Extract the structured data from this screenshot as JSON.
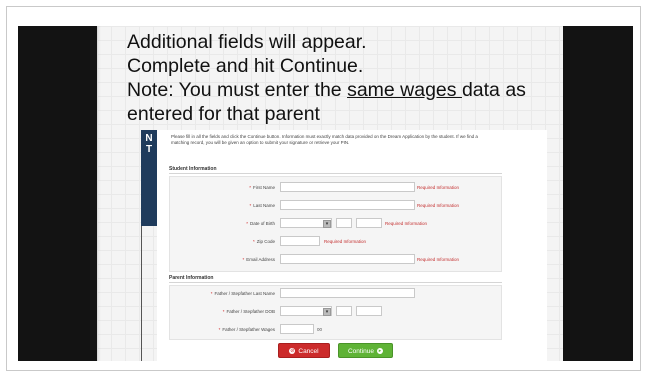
{
  "heading": {
    "line1": "Additional fields will appear.",
    "line2": "Complete and hit Continue.",
    "line3_prefix": "Note: You must enter the ",
    "line3_underlined": "same wages ",
    "line3_suffix": "data as",
    "line4": "entered for that parent"
  },
  "tab": {
    "line1": "N",
    "line2": "T"
  },
  "form": {
    "instructions": "Please fill in all the fields and click the Continue button. Information must exactly match data provided on the Dream Application by the student. If we find a matching record, you will be given an option to submit your signature or retrieve your PIN.",
    "student_section": "Student Information",
    "parent_section": "Parent Information",
    "required_text": "Required Information",
    "student_fields": [
      {
        "label": "First Name"
      },
      {
        "label": "Last Name"
      },
      {
        "label": "Date of Birth"
      },
      {
        "label": "Zip Code"
      },
      {
        "label": "Email Address"
      }
    ],
    "parent_fields": [
      {
        "label": "Father / Stepfather Last Name"
      },
      {
        "label": "Father / Stepfather DOB"
      },
      {
        "label": "Father / Stepfather Wages"
      }
    ],
    "wages_suffix": "00",
    "cancel_label": "Cancel",
    "continue_label": "Continue"
  },
  "colors": {
    "tab": "#1f3b5c",
    "cancel": "#cc2b2b",
    "continue": "#5fb336",
    "required": "#c43030"
  }
}
